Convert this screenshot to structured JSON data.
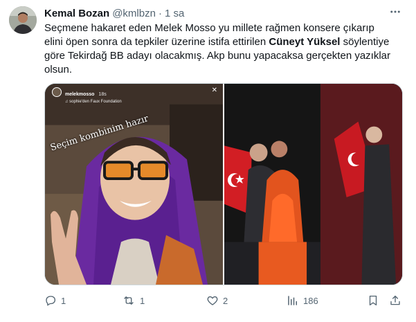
{
  "tweet": {
    "author_name": "Kemal Bozan",
    "author_handle": "@kmlbzn",
    "separator": "·",
    "time": "1 sa",
    "text_line1": "Seçmene hakaret eden Melek Mosso yu millete rağmen konsere çıkarıp",
    "text_line2_before": "elini öpen sonra da tepkiler üzerine istifa ettirilen ",
    "text_line2_bold": "Cüneyt Yüksel",
    "text_line2_after": " söylentiye",
    "text_line3": "göre Tekirdağ BB adayı olacakmış. Akp bunu yapacaksa gerçekten yazıklar",
    "text_line4": "olsun."
  },
  "media": {
    "story_username": "melekmosso",
    "story_time": "18s",
    "story_music": "♫ sophie'den Faux Foundation",
    "story_close": "✕",
    "story_caption": "Seçim kombinim hazır"
  },
  "actions": {
    "replies": "1",
    "retweets": "1",
    "likes": "2",
    "views": "186"
  },
  "icons": {
    "more": "more-icon",
    "reply": "reply-icon",
    "retweet": "retweet-icon",
    "like": "heart-icon",
    "views": "views-icon",
    "bookmark": "bookmark-icon",
    "share": "share-icon"
  },
  "colors": {
    "text": "#0f1419",
    "secondary": "#536471",
    "border": "#cfd9de"
  }
}
